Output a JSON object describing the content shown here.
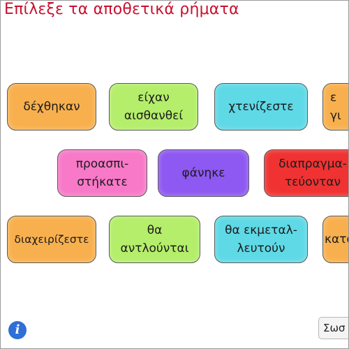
{
  "title": "Επίλεξε τα αποθετικά ρήματα",
  "cards": [
    {
      "text": "δέχθηκαν",
      "color": "#f8b04e"
    },
    {
      "text": "είχαν αισθανθεί",
      "color": "#b4ee6a"
    },
    {
      "text": "χτενίζεστε",
      "color": "#5fd9e6"
    },
    {
      "text": "ε γι",
      "color": "#f8b04e"
    },
    {
      "text": "προασπι- στήκατε",
      "color": "#f779c8"
    },
    {
      "text": "φάνηκε",
      "color": "#8e58f2"
    },
    {
      "text": "διαπραγμα- τεύονταν",
      "color": "#f03232"
    },
    {
      "text": "διαχειρίζεστε",
      "color": "#f8b04e"
    },
    {
      "text": "θα αντλούνται",
      "color": "#b4ee6a"
    },
    {
      "text": "θα εκμεταλ- λευτούν",
      "color": "#5fd9e6"
    },
    {
      "text": "κατα",
      "color": "#f8b04e"
    }
  ],
  "info_glyph": "i",
  "check_label": "Σωσ"
}
